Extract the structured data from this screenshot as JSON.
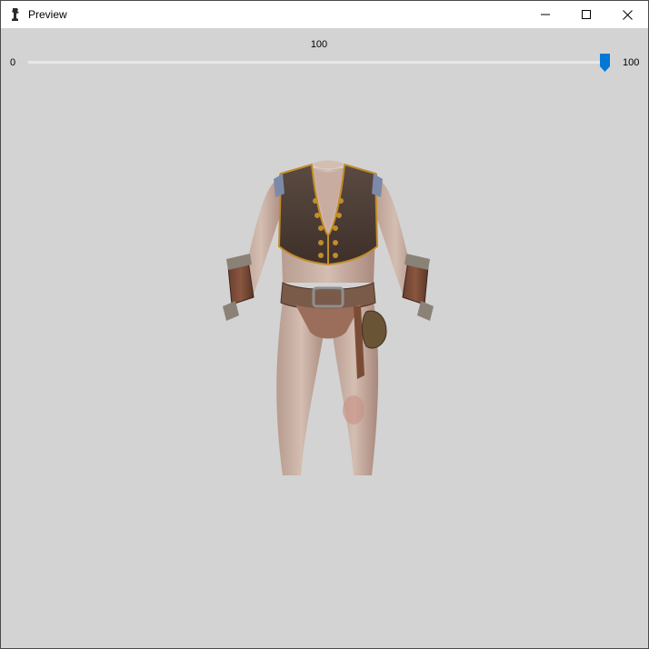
{
  "window": {
    "title": "Preview",
    "icon": "chess-piece-icon",
    "controls": {
      "minimize": "minimize-icon",
      "maximize": "maximize-icon",
      "close": "close-icon"
    }
  },
  "slider": {
    "value_label": "100",
    "min_label": "0",
    "max_label": "100",
    "value": 100,
    "min": 0,
    "max": 100,
    "accent": "#0078d7"
  },
  "preview": {
    "background": "#d3d3d3",
    "subject": "armor-outfit-model"
  }
}
